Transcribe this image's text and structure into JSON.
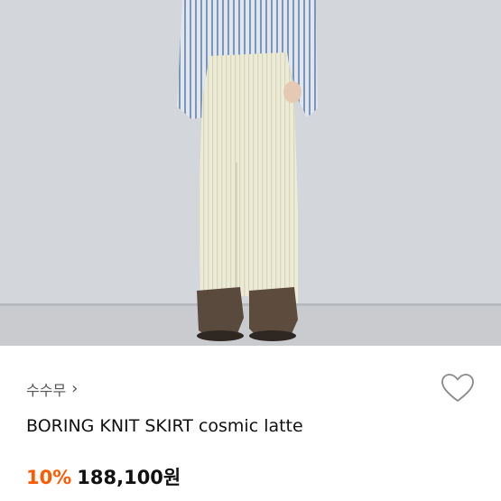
{
  "product": {
    "image_alt": "Model wearing a cream knit skirt",
    "brand": "수수무",
    "brand_chevron": "›",
    "title": "BORING KNIT SKIRT cosmic latte",
    "discount": "10%",
    "price": "188,100원"
  },
  "icons": {
    "chevron": "chevron-right-icon",
    "wishlist": "heart-outline-icon"
  },
  "colors": {
    "discount": "#ff5a00",
    "text": "#111111",
    "brand_text": "#555555"
  }
}
